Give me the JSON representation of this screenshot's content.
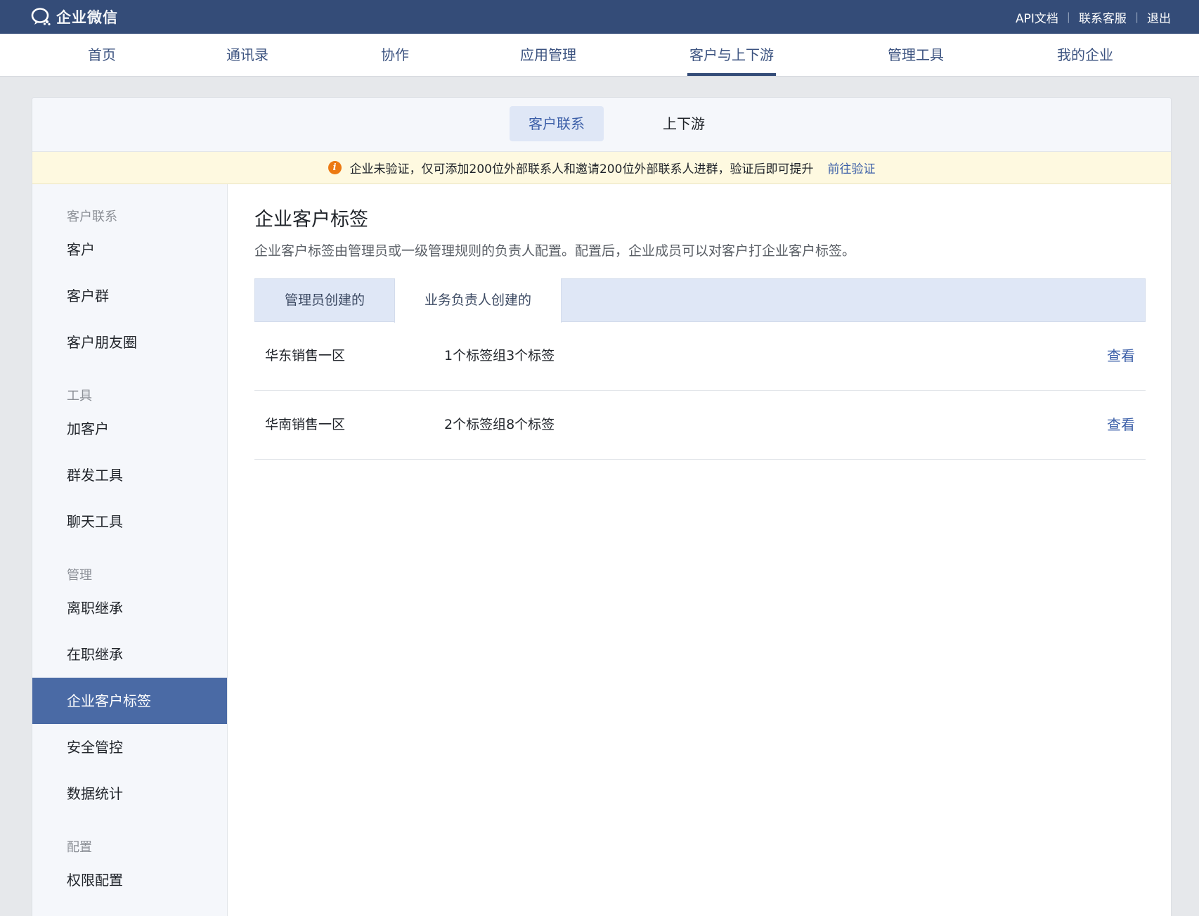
{
  "app": {
    "logo_text": "企业微信",
    "links": [
      "API文档",
      "联系客服",
      "退出"
    ]
  },
  "main_nav": [
    "首页",
    "通讯录",
    "协作",
    "应用管理",
    "客户与上下游",
    "管理工具",
    "我的企业"
  ],
  "sub_tabs": [
    "客户联系",
    "上下游"
  ],
  "notice": {
    "text": "企业未验证，仅可添加200位外部联系人和邀请200位外部联系人进群，验证后即可提升",
    "link": "前往验证"
  },
  "sidebar": {
    "group_contact": "客户联系",
    "customers": "客户",
    "customer_groups": "客户群",
    "moments": "客户朋友圈",
    "group_tools": "工具",
    "add_customer": "加客户",
    "broadcast": "群发工具",
    "chat_tools": "聊天工具",
    "group_manage": "管理",
    "resigned_inherit": "离职继承",
    "onjob_inherit": "在职继承",
    "tags": "企业客户标签",
    "security": "安全管控",
    "stats": "数据统计",
    "group_config": "配置",
    "permissions": "权限配置"
  },
  "content": {
    "title": "企业客户标签",
    "description": "企业客户标签由管理员或一级管理规则的负责人配置。配置后，企业成员可以对客户打企业客户标签。",
    "tabs": [
      "管理员创建的",
      "业务负责人创建的"
    ],
    "rows": [
      {
        "name": "华东销售一区",
        "summary": "1个标签组3个标签",
        "action": "查看"
      },
      {
        "name": "华南销售一区",
        "summary": "2个标签组8个标签",
        "action": "查看"
      }
    ]
  },
  "colors": {
    "topbar": "#344c78",
    "accent": "#3c5fa8",
    "sidebar_active": "#4a6aa5",
    "notice_bg": "#fef9e0",
    "notice_icon": "#ec7a13"
  }
}
